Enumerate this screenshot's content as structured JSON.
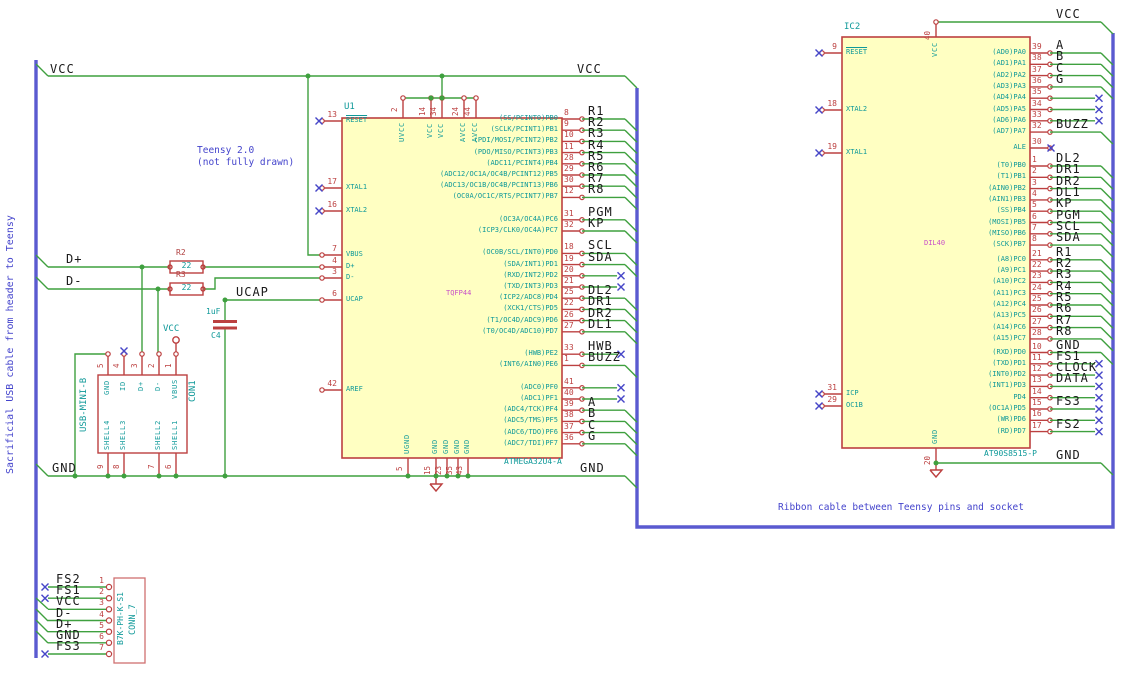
{
  "notes": {
    "cable": "Sacrificial USB cable from header to Teensy",
    "teensy1": "Teensy 2.0",
    "teensy2": "(not fully drawn)",
    "ribbon": "Ribbon cable between Teensy pins and socket"
  },
  "net_labels": {
    "vcc": "VCC",
    "gnd": "GND",
    "dplus": "D+",
    "dminus": "D-",
    "ucap": "UCAP"
  },
  "u1": {
    "ref": "U1",
    "value": "ATMEGA32U4-A",
    "footprint": "TQFP44",
    "left_pins": [
      {
        "num": "13",
        "name": "RESET",
        "nc": true,
        "ov": true
      },
      {
        "num": "17",
        "name": "XTAL1",
        "nc": true
      },
      {
        "num": "16",
        "name": "XTAL2",
        "nc": true
      },
      {
        "num": "7",
        "name": "VBUS"
      },
      {
        "num": "4",
        "name": "D+"
      },
      {
        "num": "3",
        "name": "D-"
      },
      {
        "num": "6",
        "name": "UCAP"
      },
      {
        "num": "42",
        "name": "AREF"
      }
    ],
    "right_pins": [
      {
        "num": "8",
        "name": "(SS/PCINT0)PB0",
        "label": "R1"
      },
      {
        "num": "9",
        "name": "(SCLK/PCINT1)PB1",
        "label": "R2"
      },
      {
        "num": "10",
        "name": "(PDI/MOSI/PCINT2)PB2",
        "label": "R3"
      },
      {
        "num": "11",
        "name": "(PDO/MISO/PCINT3)PB3",
        "label": "R4"
      },
      {
        "num": "28",
        "name": "(ADC11/PCINT4)PB4",
        "label": "R5"
      },
      {
        "num": "29",
        "name": "(ADC12/OC1A/OC4B/PCINT12)PB5",
        "label": "R6"
      },
      {
        "num": "30",
        "name": "(ADC13/OC1B/OC4B/PCINT13)PB6",
        "label": "R7"
      },
      {
        "num": "12",
        "name": "(OC0A/OC1C/RTS/PCINT7)PB7",
        "label": "R8"
      },
      {
        "num": "31",
        "name": "(OC3A/OC4A)PC6",
        "label": "PGM"
      },
      {
        "num": "32",
        "name": "(ICP3/CLK0/OC4A)PC7",
        "label": "KP"
      },
      {
        "num": "18",
        "name": "(OC0B/SCL/INT0)PD0",
        "label": "SCL"
      },
      {
        "num": "19",
        "name": "(SDA/INT1)PD1",
        "label": "SDA"
      },
      {
        "num": "20",
        "name": "(RXD/INT2)PD2",
        "nc": true
      },
      {
        "num": "21",
        "name": "(TXD/INT3)PD3",
        "nc": true
      },
      {
        "num": "25",
        "name": "(ICP2/ADC8)PD4",
        "label": "DL2"
      },
      {
        "num": "22",
        "name": "(XCK1/CTS)PD5",
        "label": "DR1"
      },
      {
        "num": "26",
        "name": "(T1/OC4D/ADC9)PD6",
        "label": "DR2"
      },
      {
        "num": "27",
        "name": "(T0/OC4D/ADC10)PD7",
        "label": "DL1"
      },
      {
        "num": "33",
        "name": "(HWB)PE2",
        "label": "HWB",
        "nc": true
      },
      {
        "num": "1",
        "name": "(INT6/AIN0)PE6",
        "label": "BUZZ"
      },
      {
        "num": "41",
        "name": "(ADC0)PF0",
        "nc": true
      },
      {
        "num": "40",
        "name": "(ADC1)PF1",
        "nc": true
      },
      {
        "num": "39",
        "name": "(ADC4/TCK)PF4",
        "label": "A"
      },
      {
        "num": "38",
        "name": "(ADC5/TMS)PF5",
        "label": "B"
      },
      {
        "num": "37",
        "name": "(ADC6/TDO)PF6",
        "label": "C"
      },
      {
        "num": "36",
        "name": "(ADC7/TDI)PF7",
        "label": "G"
      }
    ],
    "top_pins": [
      {
        "num": "2",
        "name": "UVCC"
      },
      {
        "num": "14",
        "name": "VCC"
      },
      {
        "num": "34",
        "name": "VCC"
      },
      {
        "num": "24",
        "name": "AVCC"
      },
      {
        "num": "44",
        "name": "AVCC"
      }
    ],
    "bottom_pins": [
      {
        "num": "5",
        "name": "UGND"
      },
      {
        "num": "15",
        "name": "GND"
      },
      {
        "num": "23",
        "name": "GND"
      },
      {
        "num": "35",
        "name": "GND"
      },
      {
        "num": "43",
        "name": "GND"
      }
    ]
  },
  "ic2": {
    "ref": "IC2",
    "value": "AT90S8515-P",
    "footprint": "DIL40",
    "left_pins": [
      {
        "num": "9",
        "name": "RESET",
        "nc": true,
        "ov": true
      },
      {
        "num": "18",
        "name": "XTAL2",
        "nc": true
      },
      {
        "num": "19",
        "name": "XTAL1",
        "nc": true
      },
      {
        "num": "31",
        "name": "ICP",
        "nc": true
      },
      {
        "num": "29",
        "name": "OC1B",
        "nc": true
      }
    ],
    "right_pins": [
      {
        "num": "39",
        "name": "(AD0)PA0",
        "label": "A"
      },
      {
        "num": "38",
        "name": "(AD1)PA1",
        "label": "B"
      },
      {
        "num": "37",
        "name": "(AD2)PA2",
        "label": "C"
      },
      {
        "num": "36",
        "name": "(AD3)PA3",
        "label": "G"
      },
      {
        "num": "35",
        "name": "(AD4)PA4",
        "nc": true
      },
      {
        "num": "34",
        "name": "(AD5)PA5",
        "nc": true
      },
      {
        "num": "33",
        "name": "(AD6)PA6",
        "nc": true
      },
      {
        "num": "32",
        "name": "(AD7)PA7",
        "label": "BUZZ"
      },
      {
        "num": "30",
        "name": "ALE",
        "nc": true,
        "ncNear": true
      },
      {
        "num": "1",
        "name": "(T0)PB0",
        "label": "DL2"
      },
      {
        "num": "2",
        "name": "(T1)PB1",
        "label": "DR1"
      },
      {
        "num": "3",
        "name": "(AIN0)PB2",
        "label": "DR2"
      },
      {
        "num": "4",
        "name": "(AIN1)PB3",
        "label": "DL1"
      },
      {
        "num": "5",
        "name": "(SS)PB4",
        "label": "KP"
      },
      {
        "num": "6",
        "name": "(MOSI)PB5",
        "label": "PGM"
      },
      {
        "num": "7",
        "name": "(MISO)PB6",
        "label": "SCL"
      },
      {
        "num": "8",
        "name": "(SCK)PB7",
        "label": "SDA"
      },
      {
        "num": "21",
        "name": "(A8)PC0",
        "label": "R1"
      },
      {
        "num": "22",
        "name": "(A9)PC1",
        "label": "R2"
      },
      {
        "num": "23",
        "name": "(A10)PC2",
        "label": "R3"
      },
      {
        "num": "24",
        "name": "(A11)PC3",
        "label": "R4"
      },
      {
        "num": "25",
        "name": "(A12)PC4",
        "label": "R5"
      },
      {
        "num": "26",
        "name": "(A13)PC5",
        "label": "R6"
      },
      {
        "num": "27",
        "name": "(A14)PC6",
        "label": "R7"
      },
      {
        "num": "28",
        "name": "(A15)PC7",
        "label": "R8"
      },
      {
        "num": "10",
        "name": "(RXD)PD0",
        "label": "GND"
      },
      {
        "num": "11",
        "name": "(TXD)PD1",
        "label": "FS1",
        "nc": true
      },
      {
        "num": "12",
        "name": "(INT0)PD2",
        "label": "CLOCK",
        "nc": true
      },
      {
        "num": "13",
        "name": "(INT1)PD3",
        "label": "DATA",
        "nc": true
      },
      {
        "num": "14",
        "name": "PD4",
        "nc": true
      },
      {
        "num": "15",
        "name": "(OC1A)PD5",
        "label": "FS3",
        "nc": true
      },
      {
        "num": "16",
        "name": "(WR)PD6",
        "nc": true
      },
      {
        "num": "17",
        "name": "(RD)PD7",
        "label": "FS2",
        "nc": true
      }
    ],
    "top_pins": [
      {
        "num": "40",
        "name": "VCC"
      }
    ],
    "bottom_pins": [
      {
        "num": "20",
        "name": "GND"
      }
    ]
  },
  "con1": {
    "ref": "CON1",
    "value": "USB-MINI-B",
    "top_pins": [
      {
        "num": "5",
        "name": "GND"
      },
      {
        "num": "4",
        "name": "ID",
        "nc": true
      },
      {
        "num": "3",
        "name": "D+"
      },
      {
        "num": "2",
        "name": "D-"
      },
      {
        "num": "1",
        "name": "VBUS"
      }
    ],
    "bottom_pins": [
      {
        "num": "9",
        "name": "SHELL4"
      },
      {
        "num": "8",
        "name": "SHELL3"
      },
      {
        "num": "7",
        "name": "SHELL2"
      },
      {
        "num": "6",
        "name": "SHELL1"
      }
    ]
  },
  "r2": {
    "ref": "R2",
    "value": "22"
  },
  "r3": {
    "ref": "R3",
    "value": "22"
  },
  "c4": {
    "ref": "C4",
    "value": "1uF"
  },
  "conn7": {
    "ref": "CONN_7",
    "value": "B7K-PH-K-S1",
    "pins": [
      {
        "num": "1",
        "label": "FS2",
        "nc": true
      },
      {
        "num": "2",
        "label": "FS1",
        "nc": true
      },
      {
        "num": "3",
        "label": "VCC"
      },
      {
        "num": "4",
        "label": "D-"
      },
      {
        "num": "5",
        "label": "D+"
      },
      {
        "num": "6",
        "label": "GND"
      },
      {
        "num": "7",
        "label": "FS3",
        "nc": true
      }
    ]
  },
  "colors": {
    "wire": "#3FA03F",
    "bus": "#5A5AD0",
    "component": "#BC4040",
    "pin_name": "#0F9999",
    "footprint": "#C850C8",
    "net_label": "#1A1A1A",
    "no_connect": "#4646C8",
    "note": "#4444CC",
    "body_fill": "#FFFFC2"
  }
}
